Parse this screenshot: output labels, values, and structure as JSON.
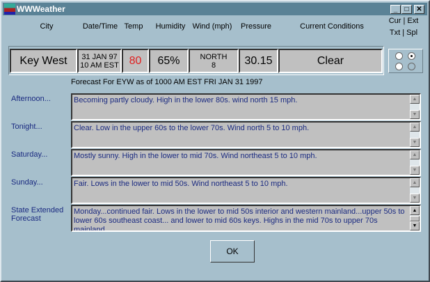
{
  "window": {
    "title": "WWWeather",
    "minimize": "_",
    "maximize": "□",
    "close": "✕"
  },
  "headers": {
    "city": "City",
    "datetime": "Date/Time",
    "temp": "Temp",
    "humidity": "Humidity",
    "wind": "Wind (mph)",
    "pressure": "Pressure",
    "conditions": "Current Conditions",
    "mode_line1": "Cur | Ext",
    "mode_line2": "Txt | Spl"
  },
  "current": {
    "city": "Key West",
    "date": "31 JAN 97",
    "time": "10 AM EST",
    "temp": "80",
    "humidity": "65%",
    "wind_dir": "NORTH",
    "wind_speed": "8",
    "pressure": "30.15",
    "conditions": "Clear"
  },
  "colors": {
    "temp": "#e02020",
    "forecast_text": "#1a2a80"
  },
  "mode": {
    "selected": "Ext Txt"
  },
  "forecast": {
    "header": "Forecast  For EYW as of 1000 AM EST FRI JAN 31 1997",
    "periods": [
      {
        "label": "Afternoon...",
        "text": "Becoming partly cloudy. High in the lower 80s.  wind north 15 mph."
      },
      {
        "label": "Tonight...",
        "text": "Clear. Low in the upper 60s to the lower 70s. Wind  north 5 to 10 mph."
      },
      {
        "label": "Saturday...",
        "text": "Mostly sunny. High in the lower to mid 70s. Wind  northeast 5 to 10 mph."
      },
      {
        "label": "Sunday...",
        "text": "Fair. Lows in the lower to mid 50s. Wind  northeast 5 to 10 mph."
      },
      {
        "label": "State Extended Forecast",
        "text": "Monday...continued fair. Lows in the lower to mid 50s interior   and western mainland...upper 50s to lower 60s southeast coast...  and lower to mid 60s keys. Highs in the mid 70s to upper 70s  mainland"
      }
    ]
  },
  "ok_label": "OK"
}
